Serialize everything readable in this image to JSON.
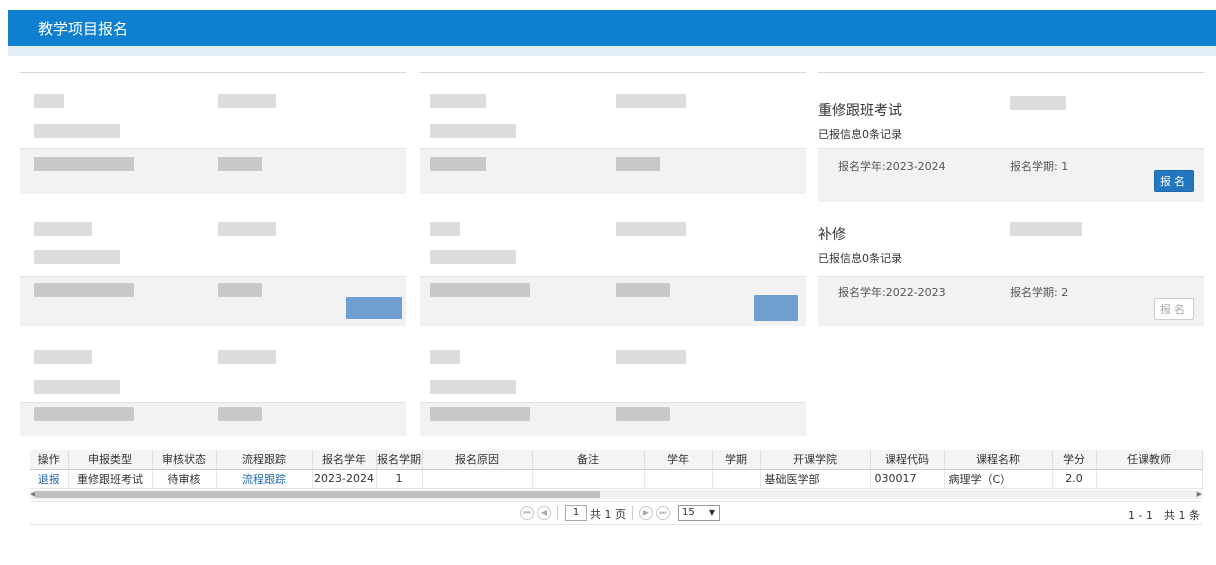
{
  "header": {
    "title": "教学项目报名"
  },
  "projects": [
    {
      "title": "重修跟班考试",
      "count_text": "已报信息0条记录",
      "year_label": "报名学年:2023-2024",
      "term_label": "报名学期: 1",
      "apply_label": "报名",
      "apply_enabled": true
    },
    {
      "title": "补修",
      "count_text": "已报信息0条记录",
      "year_label": "报名学年:2022-2023",
      "term_label": "报名学期: 2",
      "apply_label": "报名",
      "apply_enabled": false
    }
  ],
  "table": {
    "columns": [
      "操作",
      "申报类型",
      "审核状态",
      "流程跟踪",
      "报名学年",
      "报名学期",
      "报名原因",
      "备注",
      "学年",
      "学期",
      "开课学院",
      "课程代码",
      "课程名称",
      "学分",
      "任课教师"
    ],
    "rows": [
      {
        "action": "退报",
        "type": "重修跟班考试",
        "status": "待审核",
        "trace": "流程跟踪",
        "year": "2023-2024",
        "term": "1",
        "reason": "",
        "remark": "",
        "xn": "",
        "xq": "",
        "college": "基础医学部",
        "code": "030017",
        "course": "病理学（C）",
        "credit": "2.0",
        "teacher": ""
      }
    ]
  },
  "pager": {
    "page": "1",
    "total_pages_text": "共 1 页",
    "page_size": "15",
    "info": "1 - 1　共 1 条"
  }
}
